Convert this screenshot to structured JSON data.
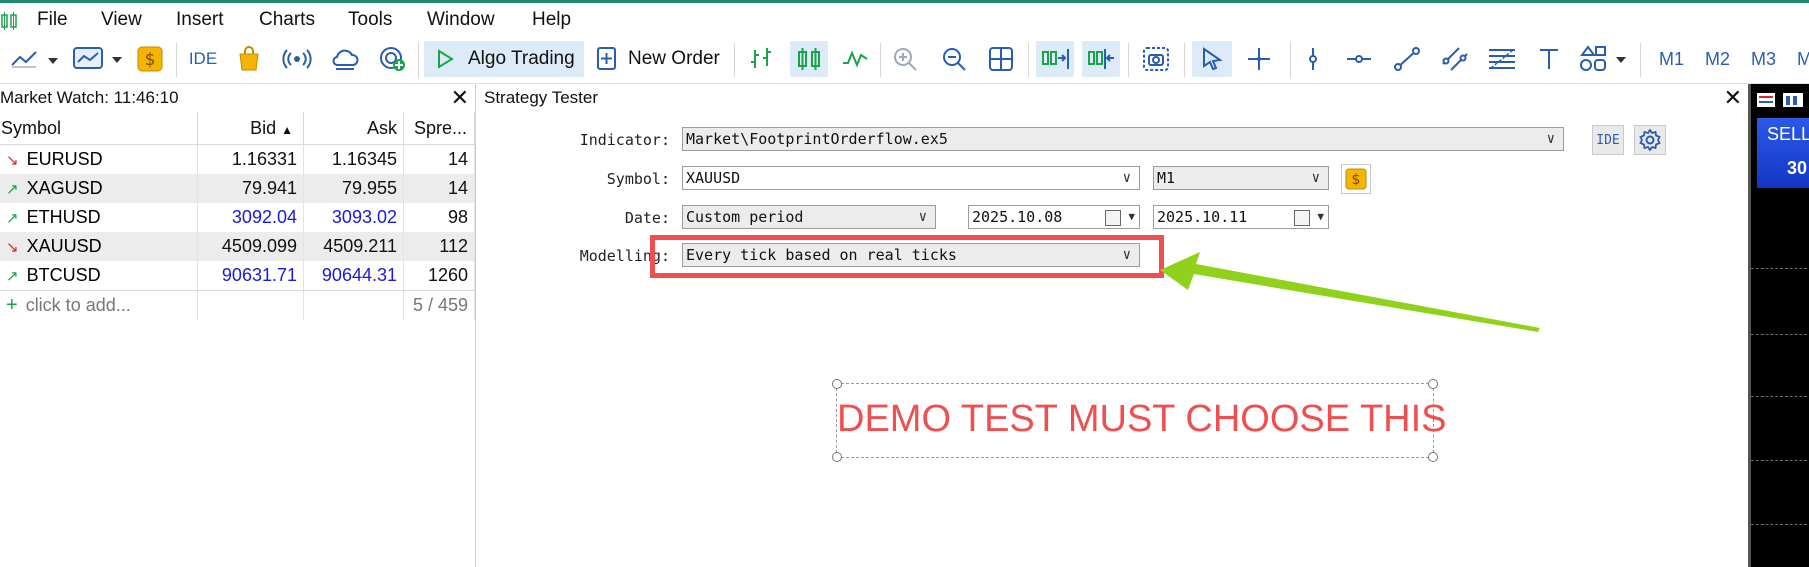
{
  "menu": {
    "items": [
      "File",
      "View",
      "Insert",
      "Charts",
      "Tools",
      "Window",
      "Help"
    ]
  },
  "toolbar": {
    "ide_label": "IDE",
    "algo_trading_label": "Algo Trading",
    "new_order_label": "New Order",
    "timeframes": [
      "M1",
      "M2",
      "M3",
      "M"
    ]
  },
  "market_watch": {
    "title": "Market Watch: 11:46:10",
    "columns": [
      "Symbol",
      "Bid",
      "Ask",
      "Spre..."
    ],
    "rows": [
      {
        "symbol": "EURUSD",
        "direction": "down",
        "bid": "1.16331",
        "ask": "1.16345",
        "spread": "14",
        "color": "dark"
      },
      {
        "symbol": "XAGUSD",
        "direction": "up",
        "bid": "79.941",
        "ask": "79.955",
        "spread": "14",
        "color": "dark"
      },
      {
        "symbol": "ETHUSD",
        "direction": "up",
        "bid": "3092.04",
        "ask": "3093.02",
        "spread": "98",
        "color": "blue"
      },
      {
        "symbol": "XAUUSD",
        "direction": "down",
        "bid": "4509.099",
        "ask": "4509.211",
        "spread": "112",
        "color": "dark"
      },
      {
        "symbol": "BTCUSD",
        "direction": "up",
        "bid": "90631.71",
        "ask": "90644.31",
        "spread": "1260",
        "color": "blue"
      }
    ],
    "add_label": "click to add...",
    "count": "5 / 459"
  },
  "strategy_tester": {
    "title": "Strategy Tester",
    "indicator_label": "Indicator:",
    "indicator_value": "Market\\FootprintOrderflow.ex5",
    "ide_button": "IDE",
    "symbol_label": "Symbol:",
    "symbol_value": "XAUUSD",
    "timeframe_value": "M1",
    "date_label": "Date:",
    "date_mode": "Custom period",
    "date_from": "2025.10.08",
    "date_to": "2025.10.11",
    "modelling_label": "Modelling:",
    "modelling_value": "Every tick based on real ticks"
  },
  "annotation": {
    "text": "DEMO TEST MUST CHOOSE THIS",
    "color": "#ef4f4f",
    "arrow_color": "#8fd11b"
  },
  "chart_strip": {
    "sell_label": "SELL",
    "sell_value": "30"
  }
}
